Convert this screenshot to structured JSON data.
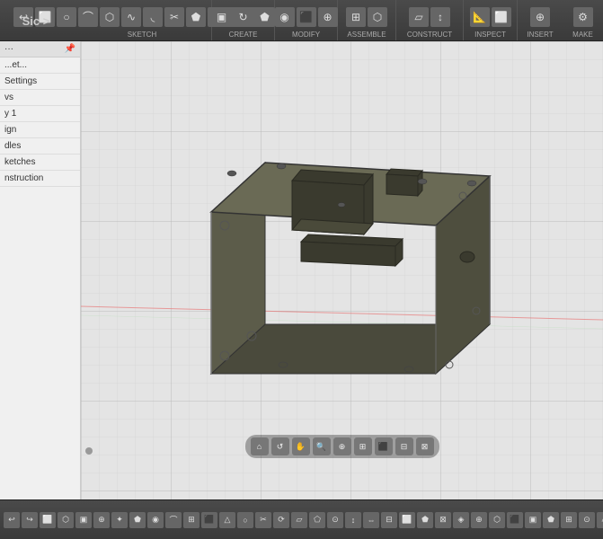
{
  "header": {
    "breadcrumb": "Sic >",
    "groups": [
      {
        "label": "SKETCH",
        "icons": [
          "↩",
          "⬜",
          "⊙",
          "△",
          "⬛",
          "⬡",
          "⟳",
          "◯",
          "⌒",
          "⬟",
          "⬡",
          "⬛",
          "⧖"
        ]
      },
      {
        "label": "CREATE",
        "icons": [
          "⬡",
          "⬛",
          "⬟"
        ]
      },
      {
        "label": "MODIFY",
        "icons": [
          "⬡",
          "⬛",
          "⬟"
        ]
      },
      {
        "label": "ASSEMBLE",
        "icons": [
          "⬡",
          "⬛"
        ]
      },
      {
        "label": "CONSTRUCT",
        "icons": [
          "⬡",
          "⬛"
        ]
      },
      {
        "label": "INSPECT",
        "icons": [
          "⬡",
          "⬛"
        ]
      },
      {
        "label": "INSERT",
        "icons": [
          "⬡"
        ]
      },
      {
        "label": "MAKE",
        "icons": [
          "⬡"
        ]
      }
    ]
  },
  "sidebar": {
    "header": "...",
    "items": [
      {
        "label": "...et..."
      },
      {
        "label": "Settings"
      },
      {
        "label": "vs"
      },
      {
        "label": "y 1"
      },
      {
        "label": "ign"
      },
      {
        "label": "dles"
      },
      {
        "label": "ketches"
      },
      {
        "label": "nstruction"
      }
    ]
  },
  "viewport": {
    "background_color": "#e4e4e4",
    "grid_color": "#cccccc",
    "axis_color": "#e87878"
  },
  "nav_controls": {
    "buttons": [
      "⌂",
      "↺",
      "🔍",
      "⊕",
      "🔍",
      "⬜",
      "⬜",
      "⬜"
    ]
  },
  "bottom_toolbar": {
    "icons_count": 40
  },
  "model": {
    "description": "3D enclosure box with cutouts",
    "color": "#5a5a4a"
  }
}
